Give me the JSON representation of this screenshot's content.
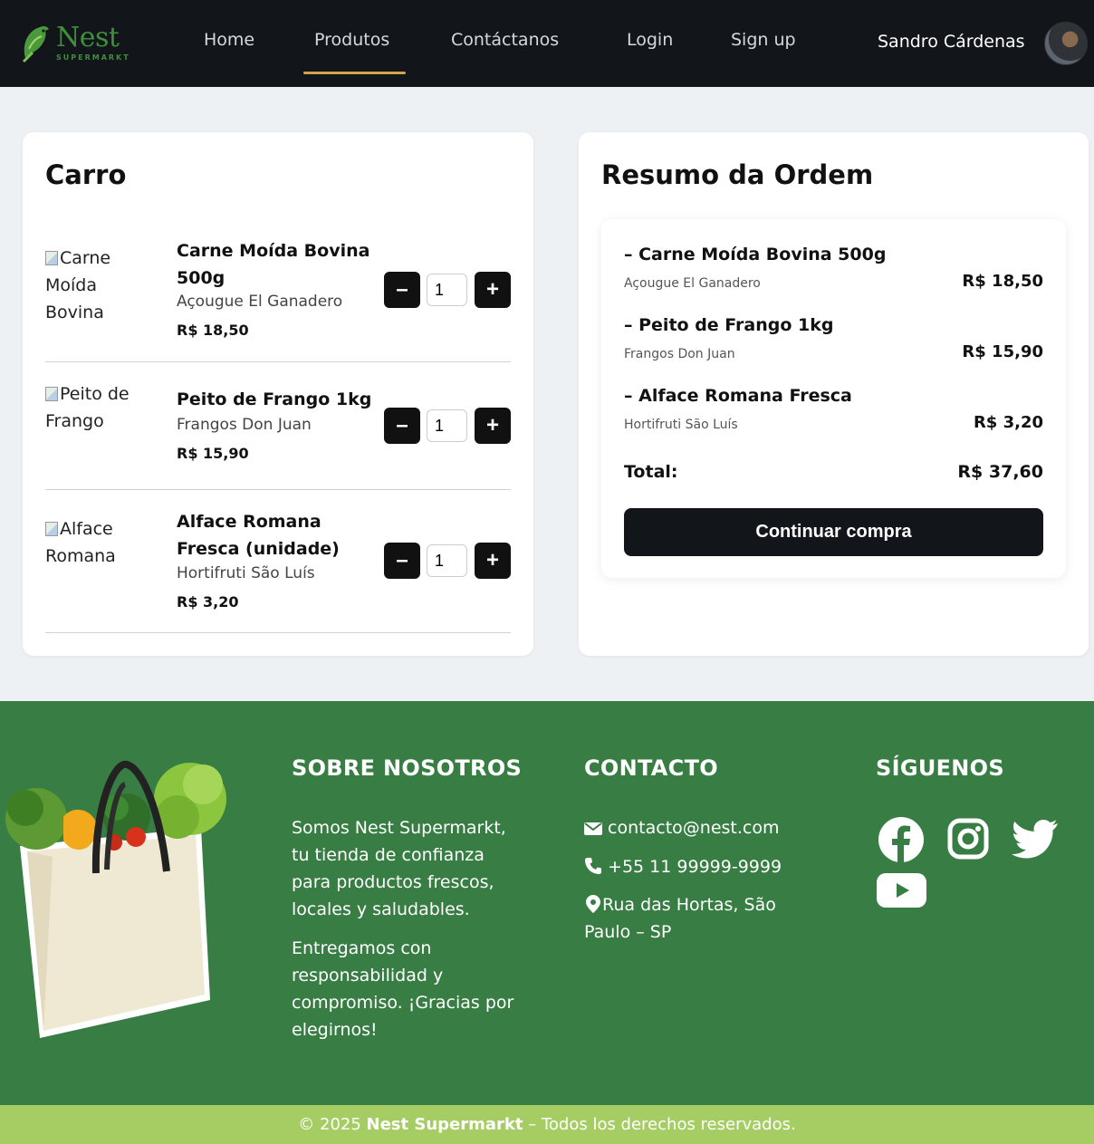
{
  "brand": {
    "name": "Nest",
    "sub": "SUPERMARKT"
  },
  "nav": {
    "items": [
      "Home",
      "Produtos",
      "Contáctanos",
      "Login",
      "Sign up"
    ],
    "active": "Produtos",
    "user": "Sandro Cárdenas"
  },
  "cart": {
    "title": "Carro",
    "items": [
      {
        "img_alt": "Carne Moída Bovina",
        "name": "Carne Moída Bovina 500g",
        "vendor": "Açougue El Ganadero",
        "price": "R$ 18,50",
        "qty": "1"
      },
      {
        "img_alt": "Peito de Frango",
        "name": "Peito de Frango 1kg",
        "vendor": "Frangos Don Juan",
        "price": "R$ 15,90",
        "qty": "1"
      },
      {
        "img_alt": "Alface Romana",
        "name": "Alface Romana Fresca (unidade)",
        "vendor": "Hortifruti São Luís",
        "price": "R$ 3,20",
        "qty": "1"
      }
    ]
  },
  "summary": {
    "title": "Resumo da Ordem",
    "items": [
      {
        "name": "– Carne Moída Bovina 500g",
        "vendor": "Açougue El Ganadero",
        "price": "R$ 18,50"
      },
      {
        "name": "– Peito de Frango 1kg",
        "vendor": "Frangos Don Juan",
        "price": "R$ 15,90"
      },
      {
        "name": "– Alface Romana Fresca",
        "vendor": "Hortifruti São Luís",
        "price": "R$ 3,20"
      }
    ],
    "total_label": "Total:",
    "total_value": "R$ 37,60",
    "continue_label": "Continuar compra"
  },
  "footer": {
    "about_heading": "SOBRE NOSOTROS",
    "about_p1": "Somos Nest Supermarkt, tu tienda de confianza para productos frescos, locales y saludables.",
    "about_p2": "Entregamos con responsabilidad y compromiso. ¡Gracias por elegirnos!",
    "contact_heading": "CONTACTO",
    "email": "contacto@nest.com",
    "phone": "+55 11 99999-9999",
    "address": "Rua das Hortas, São Paulo – SP",
    "social_heading": "SÍGUENOS",
    "social_icons": [
      "facebook-icon",
      "instagram-icon",
      "twitter-icon",
      "youtube-icon"
    ]
  },
  "copyright": {
    "prefix": "© 2025",
    "brand": "Nest Supermarkt",
    "suffix": "– Todos los derechos reservados."
  },
  "colors": {
    "nav_bg": "#12151a",
    "accent": "#d4a24c",
    "footer_green": "#387d43",
    "bottom_bar": "#a5cd63",
    "brand_green": "#3f8f3c"
  }
}
